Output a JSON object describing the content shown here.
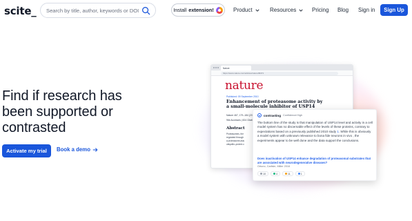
{
  "nav": {
    "logo": "scite_",
    "search_placeholder": "Search by title, author, keywords or DOI",
    "install_prefix": "Install",
    "install_bold": "extension!",
    "menu": {
      "product": "Product",
      "resources": "Resources",
      "pricing": "Pricing",
      "blog": "Blog",
      "signin": "Sign in"
    },
    "signup": "Sign Up"
  },
  "hero": {
    "title": "Find if research has been supported or contrasted",
    "primary_cta": "Activate my trial",
    "secondary_cta": "Book a demo"
  },
  "mock": {
    "tab_label": "Nature",
    "url": "https://www.nature.com/articles/nature09371",
    "journal": "nature",
    "published": "Published: 09 September 2010",
    "title": "Enhancement of proteasome activity by a small-molecule inhibitor of USP14",
    "meta": "Nature 467, 179–184 (2010)",
    "metrics": "96k Accesses | 824 Citations",
    "abstract_heading": "Abstract",
    "abstract_lines": [
      "Proteasomes, the prim",
      "regulated through conj",
      "a proteasome-associat",
      "ubiquitin–protein con"
    ]
  },
  "card": {
    "label": "contrasting",
    "confidence": "Confidence:High",
    "body_before": "The bottom line of the study is that manipulation of USP14 level and activity in a cell model system has no discernable effect of the levels of these proteins, contrary to expectations based on a previously published 2010 study ",
    "body_cite": "1",
    "body_after": ". While this is obviously a model system with unknown relevance to bona fide neurons in vivo , the experiments appear to be well done and the data support the conclusions.",
    "link": "Does inactivation of USP14 enhance degradation of proteasomal substrates that are associated with neurodegenerative diseases?",
    "authors": "Ortuno, Carlisle, Miller 2016",
    "badges": [
      "10",
      "4",
      "11",
      "1"
    ],
    "badge_colors": [
      "#9ca3af",
      "#10b981",
      "#f59e0b",
      "#3b82f6"
    ]
  }
}
